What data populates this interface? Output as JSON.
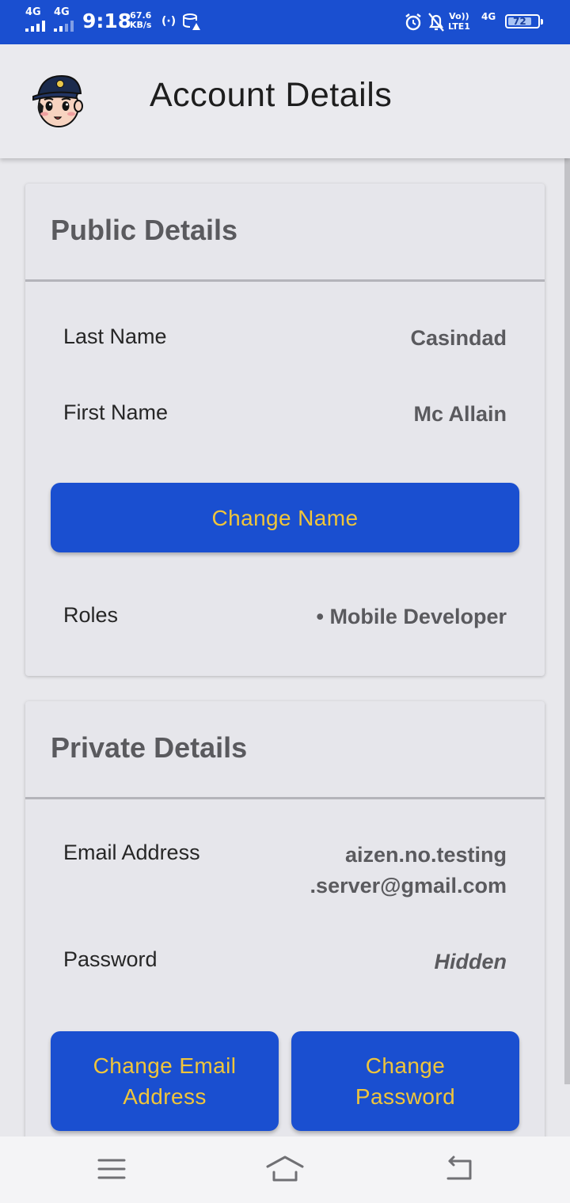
{
  "status_bar": {
    "network_1": "4G",
    "network_2": "4G",
    "time": "9:18",
    "speed_value": "67.6",
    "speed_unit": "KB/s",
    "volte_label": "Vo))",
    "lte_label": "LTE1",
    "network_3": "4G",
    "battery_level": "72",
    "background_color": "#1a4fd0",
    "icons": [
      "signal-icon",
      "hotspot-icon",
      "data-saver-icon",
      "alarm-icon",
      "notifications-off-icon",
      "battery-icon"
    ]
  },
  "app_bar": {
    "title": "Account Details",
    "avatar_icon": "cartoon-avatar-icon"
  },
  "public_details": {
    "title": "Public Details",
    "rows": [
      {
        "label": "Last Name",
        "value": "Casindad"
      },
      {
        "label": "First Name",
        "value": "Mc Allain"
      }
    ],
    "change_name_label": "Change Name",
    "roles_label": "Roles",
    "roles_value": "• Mobile Developer"
  },
  "private_details": {
    "title": "Private Details",
    "email_label": "Email Address",
    "email_value_line1": "aizen.no.testing",
    "email_value_line2": ".server@gmail.com",
    "password_label": "Password",
    "password_value": "Hidden",
    "change_email_line1": "Change Email",
    "change_email_line2": "Address",
    "change_password_line1": "Change",
    "change_password_line2": "Password"
  },
  "nav_bar": {
    "icons": [
      "menu-icon",
      "home-icon",
      "back-icon"
    ]
  },
  "colors": {
    "primary": "#1a4fd0",
    "button_text": "#f0c53a",
    "card_background": "#e6e6eb",
    "heading_gray": "#5a5a5e"
  }
}
